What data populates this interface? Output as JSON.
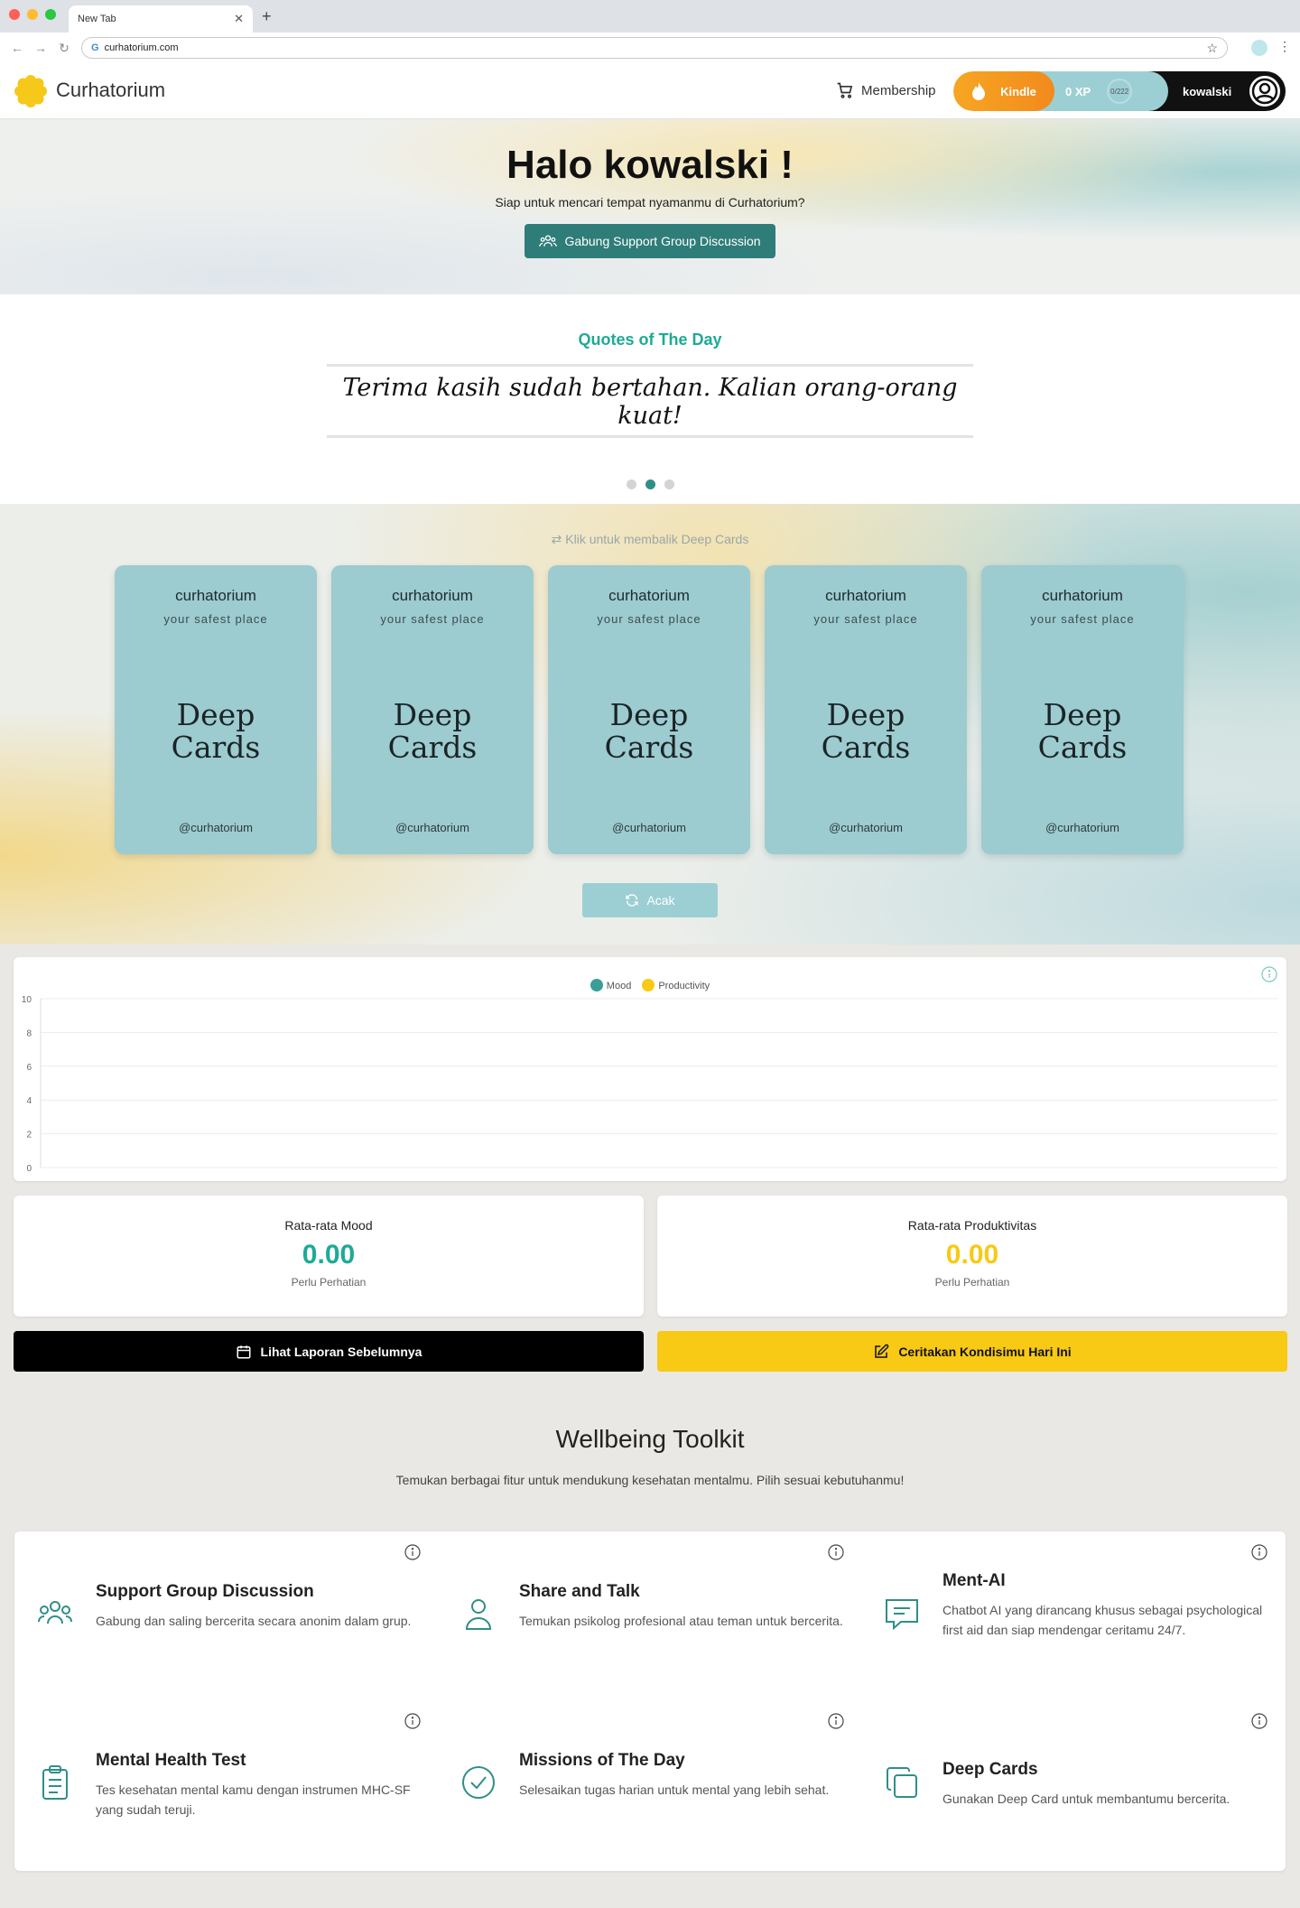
{
  "browser": {
    "tab_title": "New Tab",
    "url": "curhatorium.com"
  },
  "header": {
    "brand": "Curhatorium",
    "membership_label": "Membership",
    "kindle_label": "Kindle",
    "xp_label": "0 XP",
    "xp_progress": "0/222",
    "username": "kowalski"
  },
  "hero": {
    "greeting": "Halo kowalski !",
    "subtitle": "Siap untuk mencari tempat nyamanmu di Curhatorium?",
    "cta_label": "Gabung Support Group Discussion"
  },
  "quotes": {
    "title": "Quotes of The Day",
    "text": "Terima kasih sudah bertahan. Kalian orang-orang kuat!",
    "active_index": 1,
    "count": 3
  },
  "deep_cards": {
    "hint": "Klik untuk membalik Deep Cards",
    "shuffle_label": "Acak",
    "cards": [
      {
        "brand": "curhatorium",
        "tagline": "your safest place",
        "title_line1": "Deep",
        "title_line2": "Cards",
        "handle": "@curhatorium"
      },
      {
        "brand": "curhatorium",
        "tagline": "your safest place",
        "title_line1": "Deep",
        "title_line2": "Cards",
        "handle": "@curhatorium"
      },
      {
        "brand": "curhatorium",
        "tagline": "your safest place",
        "title_line1": "Deep",
        "title_line2": "Cards",
        "handle": "@curhatorium"
      },
      {
        "brand": "curhatorium",
        "tagline": "your safest place",
        "title_line1": "Deep",
        "title_line2": "Cards",
        "handle": "@curhatorium"
      },
      {
        "brand": "curhatorium",
        "tagline": "your safest place",
        "title_line1": "Deep",
        "title_line2": "Cards",
        "handle": "@curhatorium"
      }
    ]
  },
  "chart_data": {
    "type": "line",
    "title": "",
    "xlabel": "",
    "ylabel": "",
    "ylim": [
      0,
      10
    ],
    "yticks": [
      "0",
      "2",
      "4",
      "6",
      "8",
      "10"
    ],
    "grid": true,
    "legend_position": "top",
    "x": [],
    "series": [
      {
        "name": "Mood",
        "color": "#3a9e97",
        "values": []
      },
      {
        "name": "Productivity",
        "color": "#f8c915",
        "values": []
      }
    ]
  },
  "stats": {
    "mood": {
      "label": "Rata-rata Mood",
      "value": "0.00",
      "note": "Perlu Perhatian",
      "color": "#1eaa95"
    },
    "productivity": {
      "label": "Rata-rata Produktivitas",
      "value": "0.00",
      "note": "Perlu Perhatian",
      "color": "#f8c915"
    }
  },
  "actions": {
    "previous_report": "Lihat Laporan Sebelumnya",
    "tell_condition": "Ceritakan Kondisimu Hari Ini"
  },
  "toolkit": {
    "title": "Wellbeing Toolkit",
    "subtitle": "Temukan berbagai fitur untuk mendukung kesehatan mentalmu. Pilih sesuai kebutuhanmu!",
    "items": [
      {
        "title": "Support Group Discussion",
        "desc": "Gabung dan saling bercerita secara anonim dalam grup.",
        "icon": "group-icon"
      },
      {
        "title": "Share and Talk",
        "desc": "Temukan psikolog profesional atau teman untuk bercerita.",
        "icon": "person-icon"
      },
      {
        "title": "Ment-AI",
        "desc": "Chatbot AI yang dirancang khusus sebagai psychological first aid dan siap mendengar ceritamu 24/7.",
        "icon": "chat-icon"
      },
      {
        "title": "Mental Health Test",
        "desc": "Tes kesehatan mental kamu dengan instrumen MHC-SF yang sudah teruji.",
        "icon": "clipboard-icon"
      },
      {
        "title": "Missions of The Day",
        "desc": "Selesaikan tugas harian untuk mental yang lebih sehat.",
        "icon": "check-circle-icon"
      },
      {
        "title": "Deep Cards",
        "desc": "Gunakan Deep Card untuk membantumu bercerita.",
        "icon": "cards-icon"
      }
    ]
  },
  "colors": {
    "teal": "#2f7d78",
    "accent_teal": "#1eaa95",
    "card_bg": "#9ccbd0",
    "yellow": "#f8c915"
  }
}
